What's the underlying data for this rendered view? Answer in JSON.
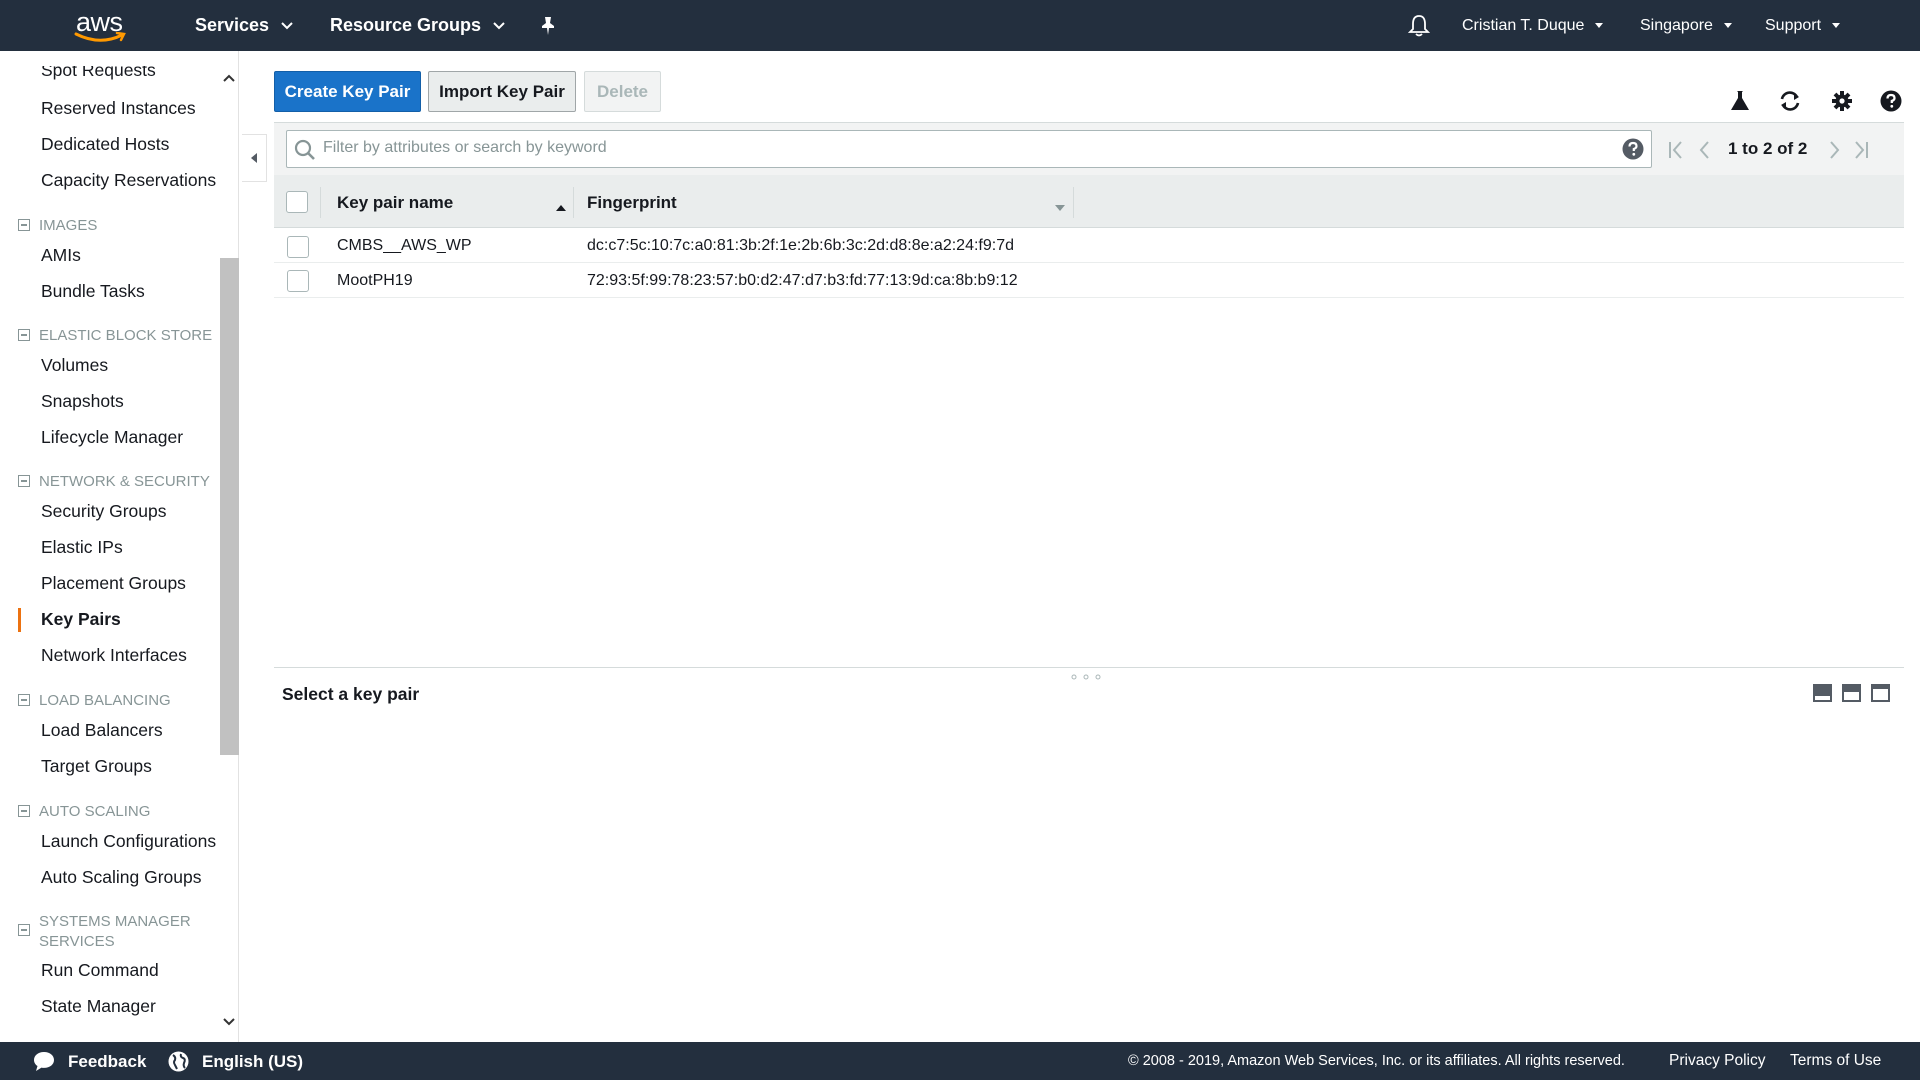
{
  "nav": {
    "logo": "aws",
    "services": "Services",
    "resource_groups": "Resource Groups",
    "user": "Cristian T. Duque",
    "region": "Singapore",
    "support": "Support"
  },
  "sidebar": {
    "items": {
      "spot_requests": "Spot Requests",
      "reserved_instances": "Reserved Instances",
      "dedicated_hosts": "Dedicated Hosts",
      "capacity_reservations": "Capacity Reservations",
      "images_section": "IMAGES",
      "amis": "AMIs",
      "bundle_tasks": "Bundle Tasks",
      "ebs_section": "ELASTIC BLOCK STORE",
      "volumes": "Volumes",
      "snapshots": "Snapshots",
      "lifecycle_manager": "Lifecycle Manager",
      "netsec_section": "NETWORK & SECURITY",
      "security_groups": "Security Groups",
      "elastic_ips": "Elastic IPs",
      "placement_groups": "Placement Groups",
      "key_pairs": "Key Pairs",
      "network_interfaces": "Network Interfaces",
      "lb_section": "LOAD BALANCING",
      "load_balancers": "Load Balancers",
      "target_groups": "Target Groups",
      "as_section": "AUTO SCALING",
      "launch_configurations": "Launch Configurations",
      "auto_scaling_groups": "Auto Scaling Groups",
      "ssm_section_1": "SYSTEMS MANAGER",
      "ssm_section_2": "SERVICES",
      "run_command": "Run Command",
      "state_manager": "State Manager"
    }
  },
  "toolbar": {
    "create": "Create Key Pair",
    "import": "Import Key Pair",
    "delete": "Delete"
  },
  "search": {
    "placeholder": "Filter by attributes or search by keyword"
  },
  "pager": {
    "text": "1 to 2 of 2"
  },
  "table": {
    "columns": [
      "Key pair name",
      "Fingerprint"
    ],
    "rows": [
      {
        "name": "CMBS__AWS_WP",
        "fingerprint": "dc:c7:5c:10:7c:a0:81:3b:2f:1e:2b:6b:3c:2d:d8:8e:a2:24:f9:7d"
      },
      {
        "name": "MootPH19",
        "fingerprint": "72:93:5f:99:78:23:57:b0:d2:47:d7:b3:fd:77:13:9d:ca:8b:b9:12"
      }
    ]
  },
  "detail": {
    "title": "Select a key pair"
  },
  "footer": {
    "feedback": "Feedback",
    "language": "English (US)",
    "copyright": "© 2008 - 2019, Amazon Web Services, Inc. or its affiliates. All rights reserved.",
    "privacy": "Privacy Policy",
    "terms": "Terms of Use"
  },
  "colors": {
    "nav_bg": "#232f3e",
    "primary": "#1a73c9",
    "active_accent": "#ec7211"
  }
}
